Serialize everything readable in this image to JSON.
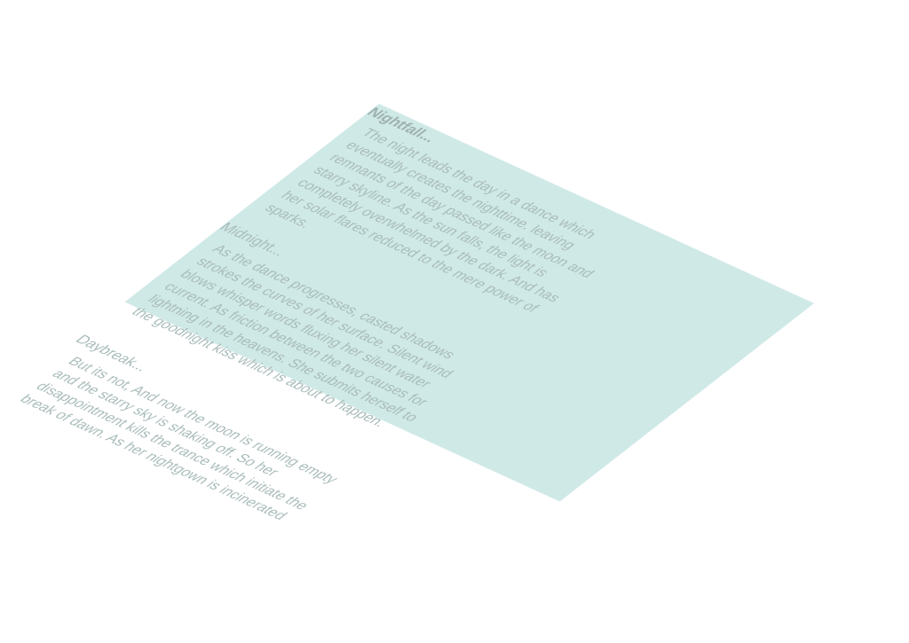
{
  "sections": [
    {
      "title": "Nightfall...",
      "lines": [
        "The night leads the day in a dance which",
        "eventually creates the nighttime. leaving",
        "remnants of the day passed like the moon and",
        "starry skyline. As the sun falls, the light is",
        "completely overwhelmed by the dark. And has",
        "her solar flares reduced to the mere power of",
        "sparks."
      ]
    },
    {
      "title": "Midnight...",
      "lines": [
        "As the dance progresses, casted shadows",
        "strokes the curves of her surface. Silent wind",
        "blows whisper words fluxing her silent water",
        "current. As friction between the two causes for",
        "lightning in the heavens. She submits  herself to",
        "the goodnight kiss which is about to happen."
      ]
    },
    {
      "title": "Daybreak...",
      "lines": [
        "But its not, And now the moon is running empty",
        "and the starry sky is shaking off. So her",
        "disappointment kills the trance which initiate the",
        "break of dawn. As her nightgown is incinerated"
      ]
    }
  ]
}
